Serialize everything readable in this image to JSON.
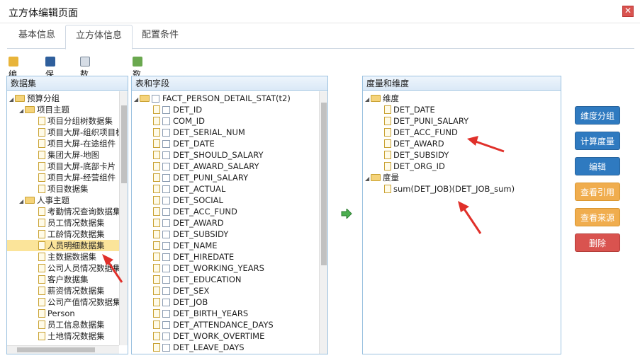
{
  "window": {
    "title": "立方体编辑页面"
  },
  "tabs": [
    {
      "label": "基本信息"
    },
    {
      "label": "立方体信息"
    },
    {
      "label": "配置条件"
    }
  ],
  "toolbar": {
    "edit": "编辑",
    "save": "保存",
    "preview": "数据预览",
    "api": "数据接口"
  },
  "dataset_panel": {
    "title": "数据集",
    "items": [
      {
        "label": "预算分组"
      },
      {
        "label": "项目主题"
      },
      {
        "label": "项目分组树数据集"
      },
      {
        "label": "项目大屏-组织项目树"
      },
      {
        "label": "项目大屏-在途组件"
      },
      {
        "label": "集团大屏-地图"
      },
      {
        "label": "项目大屏-底部卡片"
      },
      {
        "label": "项目大屏-经营组件"
      },
      {
        "label": "项目数据集"
      },
      {
        "label": "人事主题"
      },
      {
        "label": "考勤情况查询数据集"
      },
      {
        "label": "员工情况数据集"
      },
      {
        "label": "工龄情况数据集"
      },
      {
        "label": "人员明细数据集"
      },
      {
        "label": "主数据数据集"
      },
      {
        "label": "公司人员情况数据集"
      },
      {
        "label": "客户数据集"
      },
      {
        "label": "薪资情况数据集"
      },
      {
        "label": "公司产值情况数据集"
      },
      {
        "label": "Person"
      },
      {
        "label": "员工信息数据集"
      },
      {
        "label": "土地情况数据集"
      }
    ]
  },
  "fields_panel": {
    "title": "表和字段",
    "table": "FACT_PERSON_DETAIL_STAT(t2)",
    "fields": [
      "DET_ID",
      "COM_ID",
      "DET_SERIAL_NUM",
      "DET_DATE",
      "DET_SHOULD_SALARY",
      "DET_AWARD_SALARY",
      "DET_PUNI_SALARY",
      "DET_ACTUAL",
      "DET_SOCIAL",
      "DET_ACC_FUND",
      "DET_AWARD",
      "DET_SUBSIDY",
      "DET_NAME",
      "DET_HIREDATE",
      "DET_WORKING_YEARS",
      "DET_EDUCATION",
      "DET_SEX",
      "DET_JOB",
      "DET_BIRTH_YEARS",
      "DET_ATTENDANCE_DAYS",
      "DET_WORK_OVERTIME",
      "DET_LEAVE_DAYS"
    ]
  },
  "measure_panel": {
    "title": "度量和维度",
    "dimension_label": "维度",
    "dimensions": [
      "DET_DATE",
      "DET_PUNI_SALARY",
      "DET_ACC_FUND",
      "DET_AWARD",
      "DET_SUBSIDY",
      "DET_ORG_ID"
    ],
    "measure_label": "度量",
    "measures": [
      "sum(DET_JOB)(DET_JOB_sum)"
    ]
  },
  "buttons": {
    "dimension_group": "维度分组",
    "calc_measure": "计算度量",
    "edit": "编辑",
    "view_ref": "查看引用",
    "view_source": "查看来源",
    "delete": "删除"
  },
  "colors": {
    "accent_blue": "#2f7ac0",
    "orange": "#f0ad4e",
    "red": "#d9534f",
    "annotation": "#e0302a"
  }
}
